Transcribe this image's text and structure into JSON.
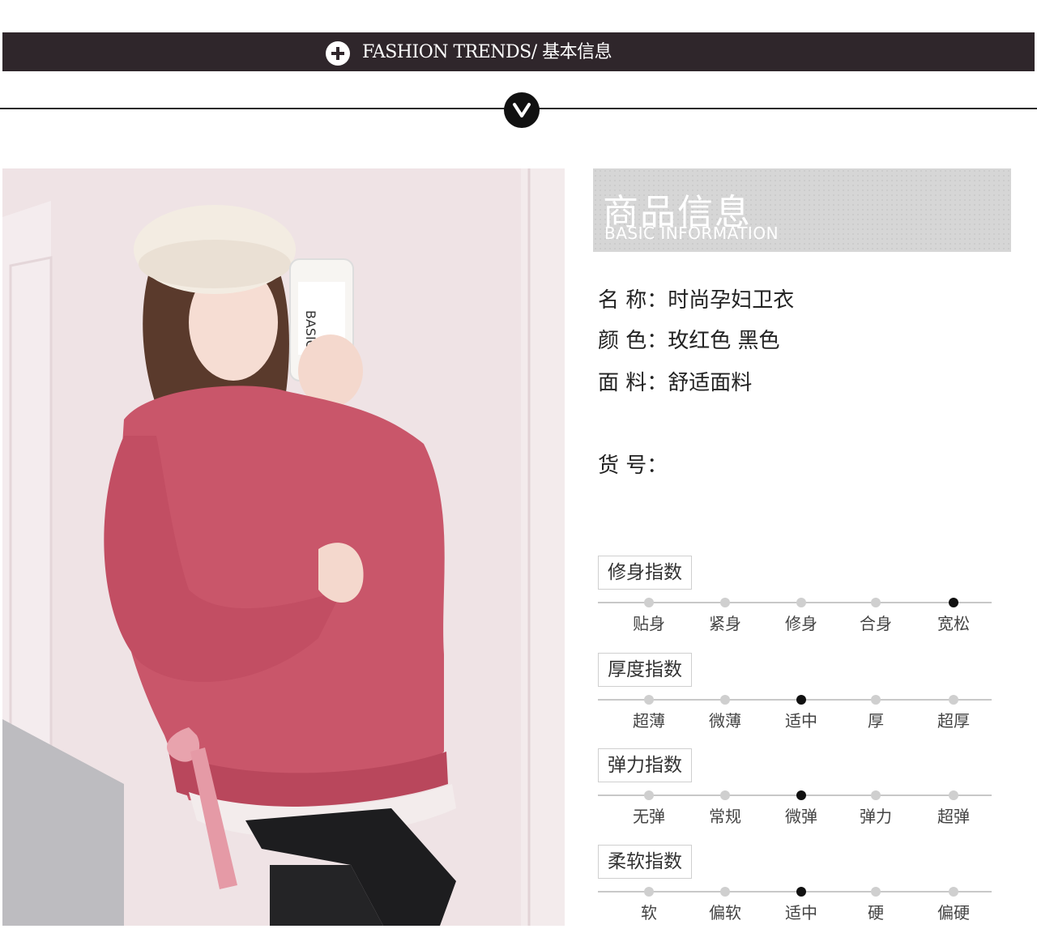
{
  "header": {
    "title": "FASHION TRENDS/  基本信息"
  },
  "banner": {
    "title_zh": "商品信息",
    "title_en": "BASIC  INFORMATION"
  },
  "info": {
    "name": "名  称：时尚孕妇卫衣",
    "color": "颜  色：玫红色    黑色",
    "fabric": "面  料：舒适面料",
    "item_no": "货  号："
  },
  "indices": [
    {
      "label": "修身指数",
      "options": [
        "贴身",
        "紧身",
        "修身",
        "合身",
        "宽松"
      ],
      "selected": 4
    },
    {
      "label": "厚度指数",
      "options": [
        "超薄",
        "微薄",
        "适中",
        "厚",
        "超厚"
      ],
      "selected": 2
    },
    {
      "label": "弹力指数",
      "options": [
        "无弹",
        "常规",
        "微弹",
        "弹力",
        "超弹"
      ],
      "selected": 2
    },
    {
      "label": "柔软指数",
      "options": [
        "软",
        "偏软",
        "适中",
        "硬",
        "偏硬"
      ],
      "selected": 2
    }
  ],
  "colors": {
    "header_bg": "#2f262b",
    "sweater": "#c9566a",
    "selected_dot": "#111111"
  }
}
